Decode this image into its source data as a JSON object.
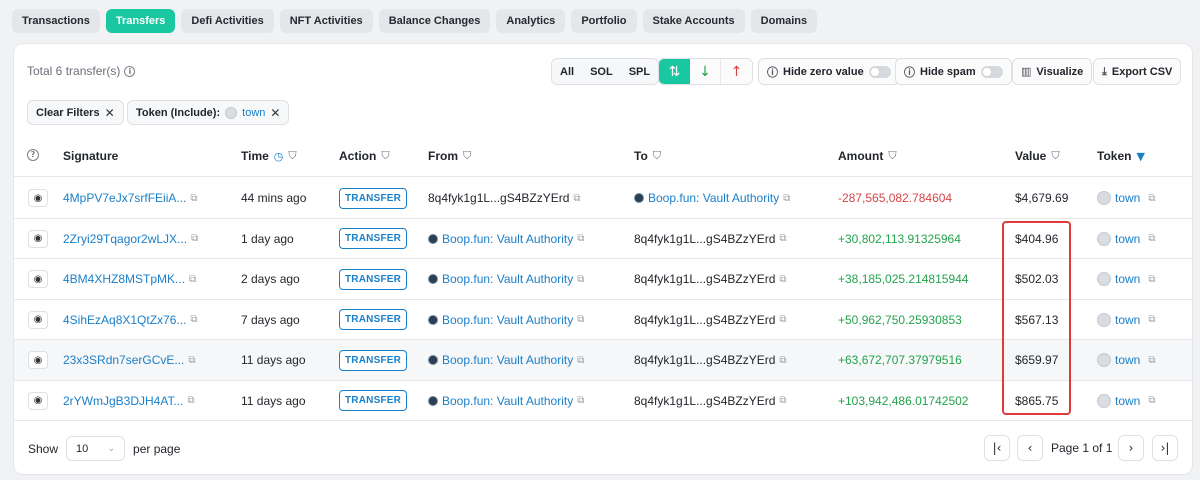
{
  "tabs": [
    "Transactions",
    "Transfers",
    "Defi Activities",
    "NFT Activities",
    "Balance Changes",
    "Analytics",
    "Portfolio",
    "Stake Accounts",
    "Domains"
  ],
  "toolbar": {
    "total": "Total 6 transfer(s)",
    "segments": [
      "All",
      "SOL",
      "SPL"
    ],
    "hide_zero": "Hide zero value",
    "hide_spam": "Hide spam",
    "visualize": "Visualize",
    "export": "Export CSV"
  },
  "filters": {
    "clear": "Clear Filters",
    "token_label": "Token (Include):",
    "token_value": "town"
  },
  "columns": {
    "signature": "Signature",
    "time": "Time",
    "action": "Action",
    "from": "From",
    "to": "To",
    "amount": "Amount",
    "value": "Value",
    "token": "Token"
  },
  "rows": [
    {
      "signature": "4MpPV7eJx7srfFEiiA...",
      "time": "44 mins ago",
      "action": "TRANSFER",
      "from": "8q4fyk1g1L...gS4BZzYErd",
      "to": "Boop.fun: Vault Authority",
      "amount": "-287,565,082.784604",
      "value": "$4,679.69",
      "token": "town"
    },
    {
      "signature": "2Zryi29Tqagor2wLJX...",
      "time": "1 day ago",
      "action": "TRANSFER",
      "from": "Boop.fun: Vault Authority",
      "to": "8q4fyk1g1L...gS4BZzYErd",
      "amount": "+30,802,113.91325964",
      "value": "$404.96",
      "token": "town"
    },
    {
      "signature": "4BM4XHZ8MSTpMK...",
      "time": "2 days ago",
      "action": "TRANSFER",
      "from": "Boop.fun: Vault Authority",
      "to": "8q4fyk1g1L...gS4BZzYErd",
      "amount": "+38,185,025.214815944",
      "value": "$502.03",
      "token": "town"
    },
    {
      "signature": "4SihEzAq8X1QtZx76...",
      "time": "7 days ago",
      "action": "TRANSFER",
      "from": "Boop.fun: Vault Authority",
      "to": "8q4fyk1g1L...gS4BZzYErd",
      "amount": "+50,962,750.25930853",
      "value": "$567.13",
      "token": "town"
    },
    {
      "signature": "23x3SRdn7serGCvE...",
      "time": "11 days ago",
      "action": "TRANSFER",
      "from": "Boop.fun: Vault Authority",
      "to": "8q4fyk1g1L...gS4BZzYErd",
      "amount": "+63,672,707.37979516",
      "value": "$659.97",
      "token": "town"
    },
    {
      "signature": "2rYWmJgB3DJH4AT...",
      "time": "11 days ago",
      "action": "TRANSFER",
      "from": "Boop.fun: Vault Authority",
      "to": "8q4fyk1g1L...gS4BZzYErd",
      "amount": "+103,942,486.01742502",
      "value": "$865.75",
      "token": "town"
    }
  ],
  "footer": {
    "show": "Show",
    "per_page_value": "10",
    "per_page": "per page",
    "page_text": "Page 1 of 1"
  },
  "colors": {
    "accent": "#19c7a0",
    "link": "#1a7fc9",
    "negative": "#d64545",
    "positive": "#23a24d",
    "highlight": "#e03b3b"
  }
}
